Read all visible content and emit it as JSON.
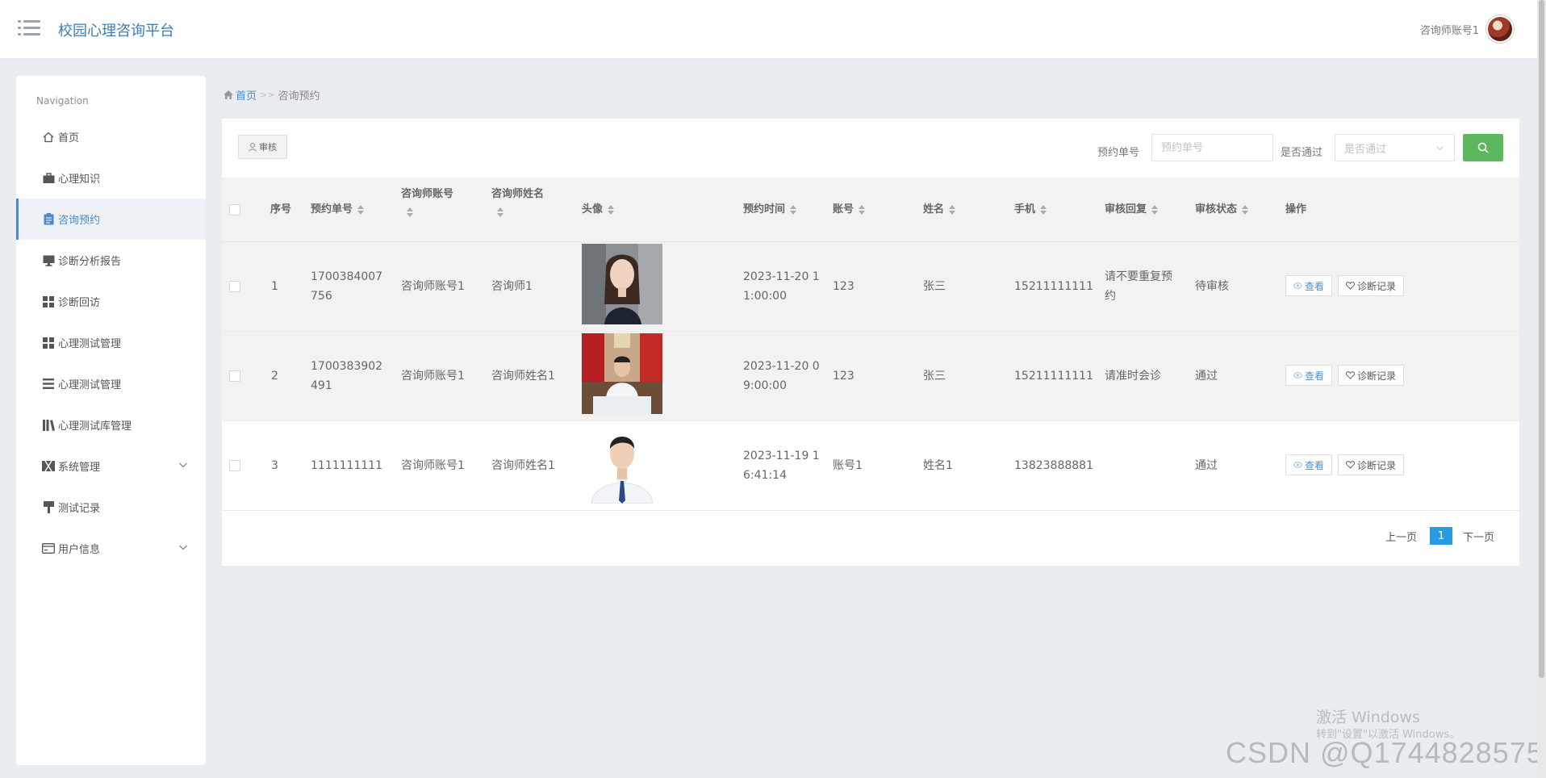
{
  "app": {
    "brand": "校园心理咨询平台",
    "user_name": "咨询师账号1"
  },
  "sidebar": {
    "title": "Navigation",
    "items": [
      {
        "label": "首页",
        "icon": "home-icon"
      },
      {
        "label": "心理知识",
        "icon": "briefcase-icon"
      },
      {
        "label": "咨询预约",
        "icon": "clipboard-icon",
        "active": true
      },
      {
        "label": "诊断分析报告",
        "icon": "monitor-icon"
      },
      {
        "label": "诊断回访",
        "icon": "grid-icon"
      },
      {
        "label": "心理测试管理",
        "icon": "grid-icon"
      },
      {
        "label": "心理测试管理",
        "icon": "list-icon"
      },
      {
        "label": "心理测试库管理",
        "icon": "library-icon"
      },
      {
        "label": "系统管理",
        "icon": "film-icon",
        "expandable": true
      },
      {
        "label": "测试记录",
        "icon": "brush-icon"
      },
      {
        "label": "用户信息",
        "icon": "id-card-icon",
        "expandable": true
      }
    ]
  },
  "breadcrumb": {
    "home": "首页",
    "separator": ">>",
    "current": "咨询预约"
  },
  "toolbar": {
    "audit_label": "审核",
    "filter_order_label": "预约单号",
    "filter_order_placeholder": "预约单号",
    "filter_pass_label": "是否通过",
    "filter_pass_placeholder": "是否通过"
  },
  "table": {
    "columns": [
      "序号",
      "预约单号",
      "咨询师账号",
      "咨询师姓名",
      "头像",
      "预约时间",
      "账号",
      "姓名",
      "手机",
      "审核回复",
      "审核状态",
      "操作"
    ],
    "rows": [
      {
        "index": "1",
        "order_no": "1700384007756",
        "counselor_account": "咨询师账号1",
        "counselor_name": "咨询师1",
        "time": "2023-11-20 11:00:00",
        "account": "123",
        "name": "张三",
        "phone": "15211111111",
        "reply": "请不要重复预约",
        "status": "待审核",
        "photo": "woman-portrait"
      },
      {
        "index": "2",
        "order_no": "1700383902491",
        "counselor_account": "咨询师账号1",
        "counselor_name": "咨询师姓名1",
        "time": "2023-11-20 09:00:00",
        "account": "123",
        "name": "张三",
        "phone": "15211111111",
        "reply": "请准时会诊",
        "status": "通过",
        "photo": "doctor-at-desk"
      },
      {
        "index": "3",
        "order_no": "1111111111",
        "counselor_account": "咨询师账号1",
        "counselor_name": "咨询师姓名1",
        "time": "2023-11-19 16:41:14",
        "account": "账号1",
        "name": "姓名1",
        "phone": "13823888881",
        "reply": "",
        "status": "通过",
        "photo": "doctor-portrait"
      }
    ],
    "actions": {
      "view": "查看",
      "records": "诊断记录"
    }
  },
  "pagination": {
    "prev": "上一页",
    "current": "1",
    "next": "下一页"
  },
  "watermark": {
    "activate_title": "激活 Windows",
    "activate_sub": "转到\"设置\"以激活 Windows。",
    "csdn": "CSDN @Q1744828575"
  },
  "colors": {
    "accent": "#4a8ac5",
    "search_button": "#5cb85c",
    "page_active": "#2a9be3",
    "background": "#e9ecf1"
  }
}
